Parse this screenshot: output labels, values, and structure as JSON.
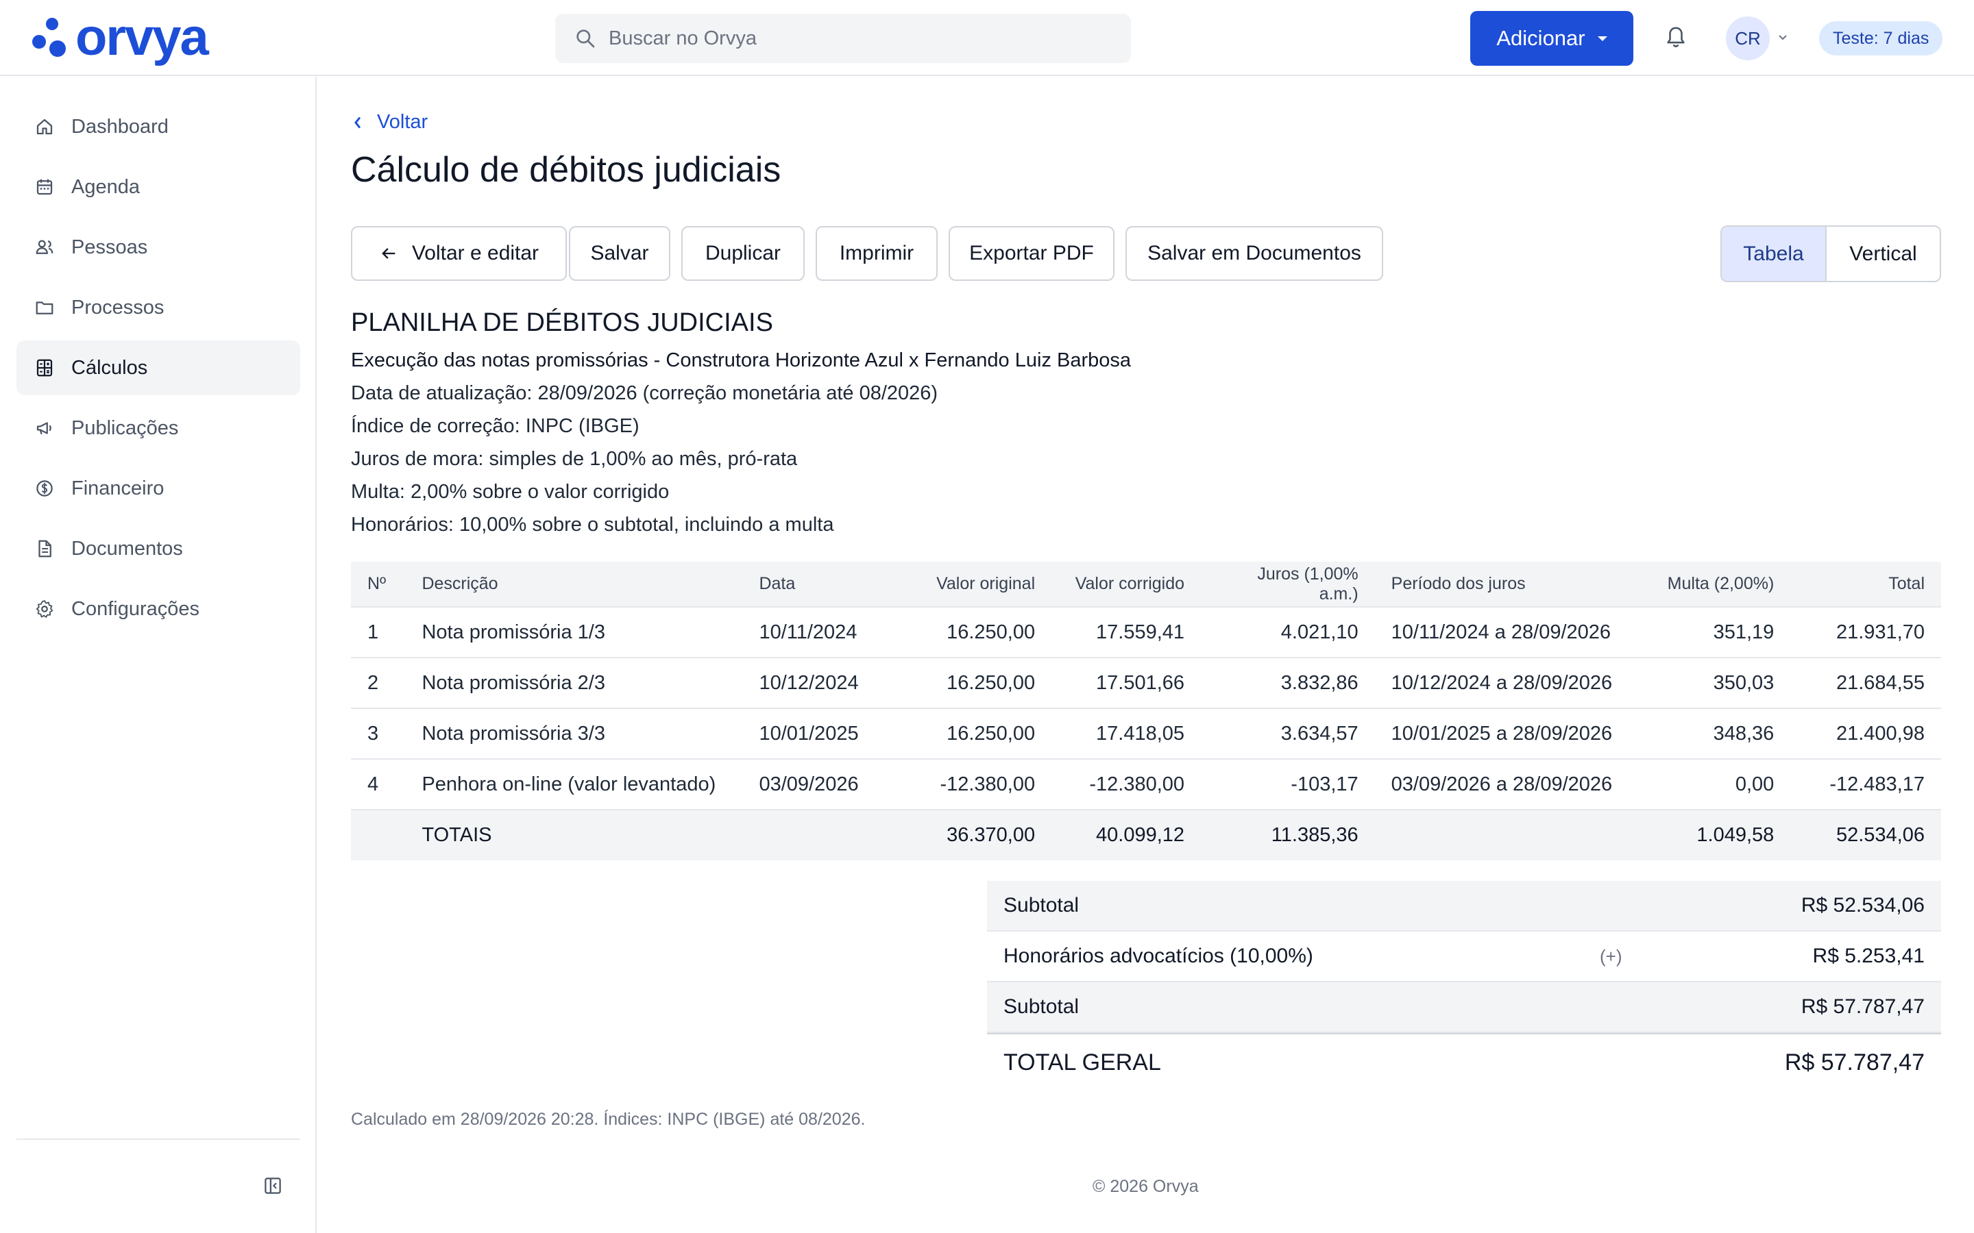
{
  "header": {
    "logo_text": "orvya",
    "brand_color": "#1d4ed8",
    "search_placeholder": "Buscar no Orvya",
    "add_label": "Adicionar",
    "avatar_initials": "CR",
    "trial_badge": "Teste: 7 dias"
  },
  "sidebar": {
    "items": [
      {
        "label": "Dashboard",
        "icon": "home-icon"
      },
      {
        "label": "Agenda",
        "icon": "calendar-icon"
      },
      {
        "label": "Pessoas",
        "icon": "users-icon"
      },
      {
        "label": "Processos",
        "icon": "folder-icon"
      },
      {
        "label": "Cálculos",
        "icon": "calculator-icon",
        "active": true
      },
      {
        "label": "Publicações",
        "icon": "megaphone-icon"
      },
      {
        "label": "Financeiro",
        "icon": "dollar-icon"
      },
      {
        "label": "Documentos",
        "icon": "document-icon"
      },
      {
        "label": "Configurações",
        "icon": "gear-icon"
      }
    ]
  },
  "main": {
    "back_label": "Voltar",
    "title": "Cálculo de débitos judiciais",
    "toolbar": {
      "back_edit": "Voltar e editar",
      "save": "Salvar",
      "duplicate": "Duplicar",
      "print": "Imprimir",
      "export_pdf": "Exportar PDF",
      "save_docs": "Salvar em Documentos"
    },
    "view_toggle": {
      "table": "Tabela",
      "vertical": "Vertical",
      "selected": "Tabela"
    },
    "sheet": {
      "title": "PLANILHA DE DÉBITOS JUDICIAIS",
      "subtitle": "Execução das notas promissórias - Construtora Horizonte Azul x Fernando Luiz Barbosa",
      "lines": [
        "Data de atualização: 28/09/2026 (correção monetária até 08/2026)",
        "Índice de correção: INPC (IBGE)",
        "Juros de mora: simples de 1,00% ao mês, pró-rata",
        "Multa: 2,00% sobre o valor corrigido",
        "Honorários: 10,00% sobre o subtotal, incluindo a multa"
      ]
    },
    "table": {
      "headers": [
        "Nº",
        "Descrição",
        "Data",
        "Valor original",
        "Valor corrigido",
        "Juros (1,00% a.m.)",
        "Período dos juros",
        "Multa (2,00%)",
        "Total"
      ],
      "rows": [
        [
          "1",
          "Nota promissória 1/3",
          "10/11/2024",
          "16.250,00",
          "17.559,41",
          "4.021,10",
          "10/11/2024 a 28/09/2026",
          "351,19",
          "21.931,70"
        ],
        [
          "2",
          "Nota promissória 2/3",
          "10/12/2024",
          "16.250,00",
          "17.501,66",
          "3.832,86",
          "10/12/2024 a 28/09/2026",
          "350,03",
          "21.684,55"
        ],
        [
          "3",
          "Nota promissória 3/3",
          "10/01/2025",
          "16.250,00",
          "17.418,05",
          "3.634,57",
          "10/01/2025 a 28/09/2026",
          "348,36",
          "21.400,98"
        ],
        [
          "4",
          "Penhora on-line (valor levantado)",
          "03/09/2026",
          "-12.380,00",
          "-12.380,00",
          "-103,17",
          "03/09/2026 a 28/09/2026",
          "0,00",
          "-12.483,17"
        ]
      ],
      "totals": [
        "",
        "TOTAIS",
        "",
        "36.370,00",
        "40.099,12",
        "11.385,36",
        "",
        "1.049,58",
        "52.534,06"
      ]
    },
    "summary": {
      "subtotal1_label": "Subtotal",
      "subtotal1_value": "R$ 52.534,06",
      "fees_label": "Honorários advocatícios (10,00%)",
      "fees_sign": "(+)",
      "fees_value": "R$ 5.253,41",
      "subtotal2_label": "Subtotal",
      "subtotal2_value": "R$ 57.787,47",
      "total_label": "TOTAL GERAL",
      "total_value": "R$ 57.787,47"
    },
    "calc_note": "Calculado em 28/09/2026 20:28. Índices: INPC (IBGE) até 08/2026."
  },
  "footer": "© 2026 Orvya"
}
